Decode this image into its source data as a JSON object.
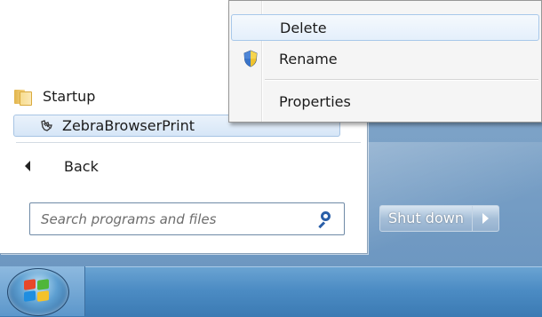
{
  "start_menu": {
    "folder_item": {
      "label": "Startup",
      "icon": "folder-icon"
    },
    "program_item": {
      "label": "ZebraBrowserPrint",
      "icon": "zebra-app-icon"
    },
    "back_label": "Back",
    "search": {
      "placeholder": "Search programs and files",
      "icon": "search-icon"
    }
  },
  "shutdown": {
    "label": "Shut down",
    "arrow_icon": "triangle-right-icon"
  },
  "context_menu": {
    "items": [
      {
        "label": "Delete",
        "icon": "",
        "highlighted": true
      },
      {
        "label": "Rename",
        "icon": "uac-shield-icon",
        "highlighted": false
      },
      {
        "label": "Properties",
        "icon": "",
        "highlighted": false
      }
    ]
  },
  "taskbar": {
    "start_icon": "windows-start-orb"
  },
  "colors": {
    "hover_border": "#a8c8ea",
    "taskbar": "#4c8cc4",
    "search_icon": "#2a5fa8"
  }
}
